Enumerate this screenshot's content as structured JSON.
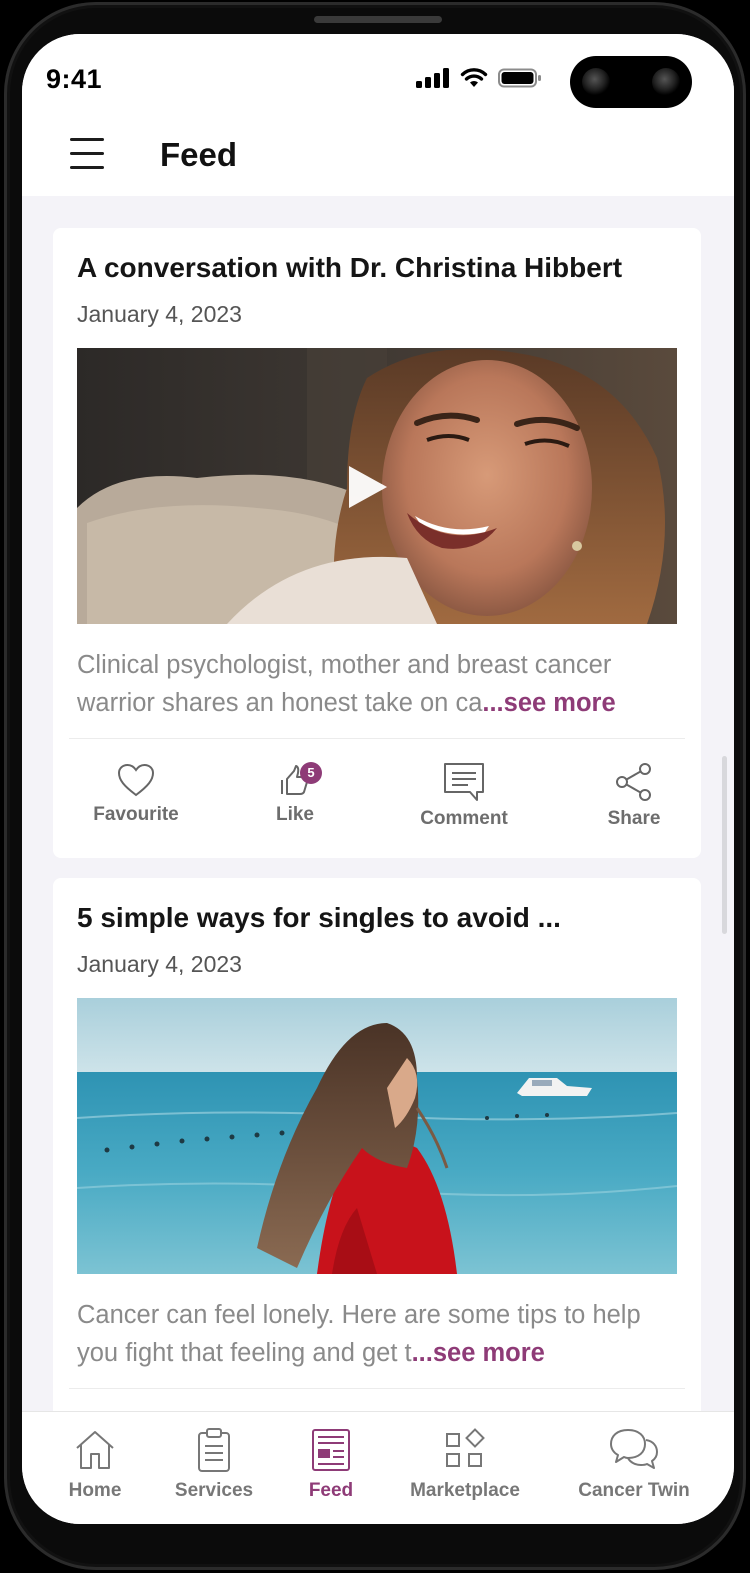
{
  "status_bar": {
    "time": "9:41"
  },
  "header": {
    "title": "Feed"
  },
  "feed": {
    "posts": [
      {
        "title": "A conversation with Dr. Christina Hibbert",
        "date": "January 4, 2023",
        "description": "Clinical psychologist, mother and breast cancer warrior shares an honest take on ca",
        "see_more": "...see more",
        "media": "video"
      },
      {
        "title": "5 simple ways for singles to avoid ...",
        "date": "January 4, 2023",
        "description": "Cancer can feel lonely. Here are some tips to help you fight that feeling and get t",
        "see_more": "...see more",
        "media": "image"
      }
    ],
    "actions": {
      "favourite": "Favourite",
      "like": "Like",
      "like_count": "5",
      "comment": "Comment",
      "share": "Share"
    }
  },
  "tab_bar": {
    "tabs": [
      {
        "label": "Home",
        "icon": "home-icon"
      },
      {
        "label": "Services",
        "icon": "clipboard-icon"
      },
      {
        "label": "Feed",
        "icon": "feed-icon",
        "active": true
      },
      {
        "label": "Marketplace",
        "icon": "marketplace-icon"
      },
      {
        "label": "Cancer Twin",
        "icon": "chat-bubbles-icon"
      }
    ]
  },
  "colors": {
    "accent": "#8e3b77",
    "background": "#f4f3f8",
    "muted_text": "#8a8a8a"
  }
}
